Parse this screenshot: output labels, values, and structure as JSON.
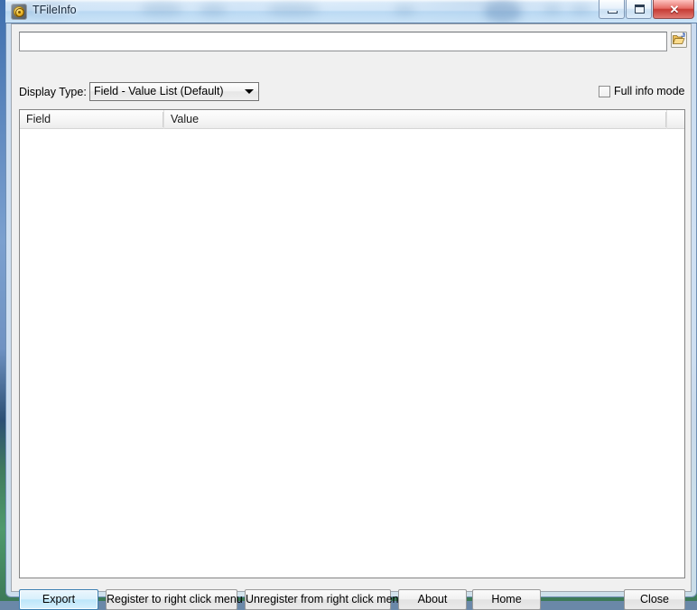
{
  "window": {
    "title": "TFileInfo",
    "icon": "app-target-icon",
    "controls": {
      "minimize": "minimize-icon",
      "maximize": "maximize-icon",
      "close": "✕"
    }
  },
  "toolbar": {
    "path_value": "",
    "path_placeholder": "",
    "browse_icon": "open-folder-icon"
  },
  "display_type": {
    "label": "Display Type:",
    "selected": "Field - Value List (Default)",
    "options": [
      "Field - Value List (Default)"
    ]
  },
  "full_info": {
    "label": "Full info mode",
    "checked": false
  },
  "listview": {
    "columns": [
      {
        "label": "Field"
      },
      {
        "label": "Value"
      }
    ],
    "rows": []
  },
  "buttons": {
    "export": "Export",
    "register": "Register to right click menu",
    "unregister": "Unregister from right click menu",
    "about": "About",
    "home": "Home",
    "close": "Close"
  },
  "colors": {
    "accent": "#3c7fb1",
    "dialog_bg": "#f0f0f0",
    "close_red": "#c6362e",
    "icon_gold": "#f6c93c"
  }
}
